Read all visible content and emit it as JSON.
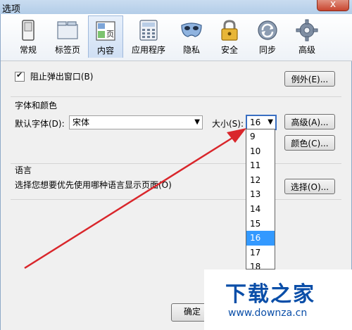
{
  "window": {
    "title": "选项",
    "close_label": "x"
  },
  "tabs": [
    {
      "label": "常规",
      "icon": "switch-icon",
      "selected": false
    },
    {
      "label": "标签页",
      "icon": "folder-icon",
      "selected": false
    },
    {
      "label": "内容",
      "icon": "page-icon",
      "selected": true
    },
    {
      "label": "应用程序",
      "icon": "calculator-icon",
      "selected": false
    },
    {
      "label": "隐私",
      "icon": "mask-icon",
      "selected": false
    },
    {
      "label": "安全",
      "icon": "lock-icon",
      "selected": false
    },
    {
      "label": "同步",
      "icon": "sync-icon",
      "selected": false
    },
    {
      "label": "高级",
      "icon": "gear-icon",
      "selected": false
    }
  ],
  "popup": {
    "checked": true,
    "label": "阻止弹出窗口(B)",
    "exceptions_button": "例外(E)..."
  },
  "fonts": {
    "group_label": "字体和颜色",
    "default_font_label": "默认字体(D):",
    "default_font_value": "宋体",
    "size_label": "大小(S):",
    "size_value": "16",
    "advanced_button": "高级(A)...",
    "colors_button": "颜色(C)...",
    "size_options": [
      "9",
      "10",
      "11",
      "12",
      "13",
      "14",
      "15",
      "16",
      "17",
      "18"
    ],
    "highlighted_option": "16"
  },
  "language": {
    "group_label": "语言",
    "description": "选择您想要优先使用哪种语言显示页面(O)",
    "choose_button": "选择(O)..."
  },
  "footer": {
    "ok_button": "确定"
  },
  "watermark": {
    "title": "下载之家",
    "url": "www.downza.cn"
  },
  "colors": {
    "annotation_arrow": "#d9262b",
    "highlight": "#3399ff"
  }
}
